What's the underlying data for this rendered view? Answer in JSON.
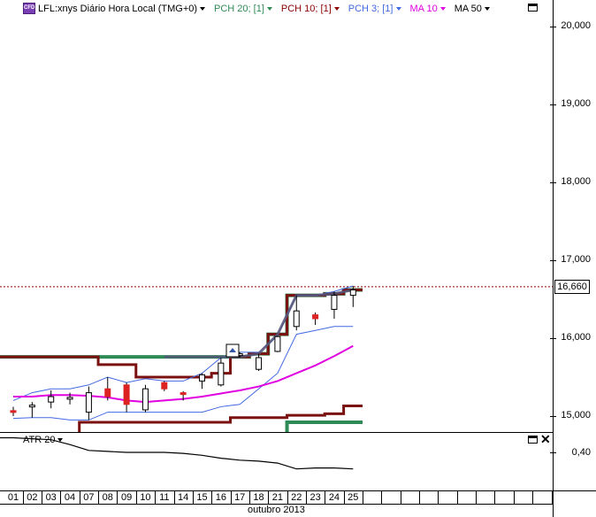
{
  "legend": {
    "symbol_badge": "CFD",
    "items": [
      {
        "label": "LFL:xnys Diário Hora Local (TMG+0)",
        "color": "#000000"
      },
      {
        "label": "PCH 20; [1]",
        "color": "#2e8b57"
      },
      {
        "label": "PCH 10; [1]",
        "color": "#8b0000"
      },
      {
        "label": "PCH 3; [1]",
        "color": "#4169e1"
      },
      {
        "label": "MA 10",
        "color": "#e000e0"
      },
      {
        "label": "MA 50",
        "color": "#000000"
      }
    ]
  },
  "price_axis": {
    "ticks": [
      "20,000",
      "19,000",
      "18,000",
      "17,000",
      "16,000",
      "15,000"
    ],
    "current_price": "16,660"
  },
  "atr_panel": {
    "label": "ATR 20",
    "ticks": [
      "0,40"
    ]
  },
  "time_axis": {
    "days": [
      "01",
      "02",
      "03",
      "04",
      "07",
      "08",
      "09",
      "10",
      "11",
      "14",
      "15",
      "16",
      "17",
      "18",
      "21",
      "22",
      "23",
      "24",
      "25"
    ],
    "month_label": "outubro 2013"
  },
  "chart_data": {
    "type": "candlestick",
    "symbol": "LFL:xnys",
    "x": [
      "01",
      "02",
      "03",
      "04",
      "07",
      "08",
      "09",
      "10",
      "11",
      "14",
      "15",
      "16",
      "17",
      "18",
      "21",
      "22",
      "23",
      "24",
      "25"
    ],
    "ohlc": [
      {
        "o": 15.07,
        "h": 15.12,
        "l": 15.0,
        "c": 15.05,
        "dir": "down"
      },
      {
        "o": 15.12,
        "h": 15.18,
        "l": 14.98,
        "c": 15.14,
        "dir": "up"
      },
      {
        "o": 15.18,
        "h": 15.33,
        "l": 15.1,
        "c": 15.25,
        "dir": "up"
      },
      {
        "o": 15.22,
        "h": 15.3,
        "l": 15.15,
        "c": 15.24,
        "dir": "up"
      },
      {
        "o": 15.05,
        "h": 15.38,
        "l": 14.95,
        "c": 15.3,
        "dir": "up"
      },
      {
        "o": 15.35,
        "h": 15.5,
        "l": 15.2,
        "c": 15.25,
        "dir": "down"
      },
      {
        "o": 15.4,
        "h": 15.43,
        "l": 15.05,
        "c": 15.15,
        "dir": "down"
      },
      {
        "o": 15.08,
        "h": 15.4,
        "l": 15.05,
        "c": 15.35,
        "dir": "up"
      },
      {
        "o": 15.43,
        "h": 15.45,
        "l": 15.32,
        "c": 15.35,
        "dir": "down"
      },
      {
        "o": 15.3,
        "h": 15.32,
        "l": 15.2,
        "c": 15.28,
        "dir": "down"
      },
      {
        "o": 15.45,
        "h": 15.55,
        "l": 15.35,
        "c": 15.53,
        "dir": "up"
      },
      {
        "o": 15.4,
        "h": 15.75,
        "l": 15.38,
        "c": 15.68,
        "dir": "up"
      },
      {
        "o": 15.78,
        "h": 15.82,
        "l": 15.75,
        "c": 15.8,
        "dir": "up"
      },
      {
        "o": 15.6,
        "h": 15.8,
        "l": 15.58,
        "c": 15.75,
        "dir": "up"
      },
      {
        "o": 15.83,
        "h": 16.03,
        "l": 15.82,
        "c": 16.02,
        "dir": "up"
      },
      {
        "o": 16.15,
        "h": 16.55,
        "l": 16.1,
        "c": 16.35,
        "dir": "up"
      },
      {
        "o": 16.3,
        "h": 16.33,
        "l": 16.17,
        "c": 16.25,
        "dir": "down"
      },
      {
        "o": 16.37,
        "h": 16.6,
        "l": 16.25,
        "c": 16.55,
        "dir": "up"
      },
      {
        "o": 16.55,
        "h": 16.67,
        "l": 16.4,
        "c": 16.62,
        "dir": "up"
      }
    ],
    "pch20_upper": [
      15.76,
      15.76,
      15.76,
      15.76,
      15.76,
      15.76,
      15.76,
      15.76,
      15.76,
      15.76,
      15.76,
      15.76,
      15.76,
      15.8,
      16.05,
      16.55,
      16.55,
      16.57,
      16.62
    ],
    "pch20_lower": [
      14.7,
      14.7,
      14.7,
      14.7,
      14.7,
      14.7,
      14.7,
      14.7,
      14.7,
      14.7,
      14.7,
      14.7,
      14.7,
      14.7,
      14.7,
      14.92,
      14.92,
      14.92,
      14.92
    ],
    "pch10_upper": [
      15.76,
      15.76,
      15.76,
      15.76,
      15.76,
      15.66,
      15.66,
      15.5,
      15.5,
      15.5,
      15.5,
      15.55,
      15.76,
      15.8,
      16.05,
      16.55,
      16.55,
      16.57,
      16.62
    ],
    "pch10_lower": [
      14.7,
      14.7,
      14.7,
      14.7,
      14.92,
      14.92,
      14.92,
      14.92,
      14.92,
      14.92,
      14.92,
      14.92,
      14.98,
      14.98,
      14.98,
      15.01,
      15.01,
      15.03,
      15.13
    ],
    "pch3_upper": [
      15.2,
      15.3,
      15.35,
      15.35,
      15.4,
      15.5,
      15.43,
      15.48,
      15.45,
      15.45,
      15.55,
      15.75,
      15.82,
      15.82,
      16.03,
      16.55,
      16.55,
      16.6,
      16.67
    ],
    "pch3_lower": [
      14.97,
      14.98,
      14.98,
      14.95,
      14.95,
      15.05,
      15.05,
      15.05,
      15.05,
      15.05,
      15.05,
      15.12,
      15.15,
      15.35,
      15.55,
      16.05,
      16.1,
      16.15,
      16.15
    ],
    "ma10": [
      15.25,
      15.25,
      15.27,
      15.27,
      15.26,
      15.24,
      15.2,
      15.18,
      15.2,
      15.22,
      15.25,
      15.29,
      15.33,
      15.38,
      15.45,
      15.55,
      15.65,
      15.77,
      15.9
    ],
    "atr20": [
      0.475,
      0.47,
      0.465,
      0.44,
      0.41,
      0.405,
      0.4,
      0.4,
      0.4,
      0.395,
      0.385,
      0.37,
      0.36,
      0.355,
      0.345,
      0.315,
      0.32,
      0.32,
      0.315
    ],
    "price_ylim": [
      14.8,
      20.3
    ],
    "atr_ylim": [
      0.29,
      0.51
    ],
    "current_price": 16.66
  }
}
